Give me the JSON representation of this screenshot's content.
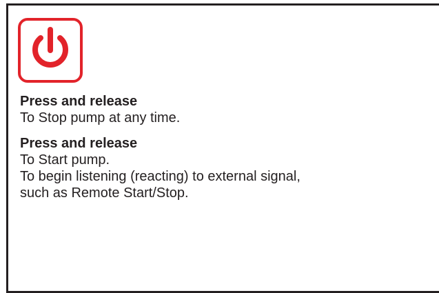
{
  "icon": {
    "name": "power-icon",
    "color": "#e2232a"
  },
  "instructions": [
    {
      "heading": "Press and release",
      "lines": [
        "To Stop pump at any time."
      ]
    },
    {
      "heading": "Press and release",
      "lines": [
        "To Start pump.",
        "To begin listening (reacting) to external signal,",
        "such as Remote Start/Stop."
      ]
    }
  ]
}
